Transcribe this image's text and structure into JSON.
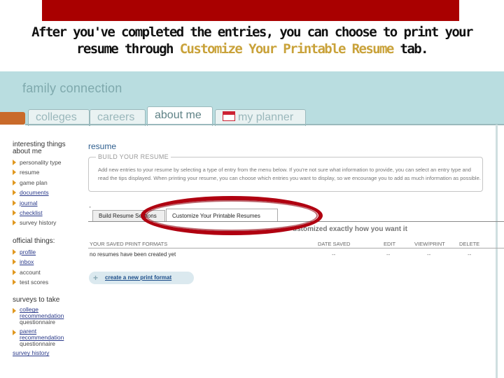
{
  "caption": {
    "line1": "After you've completed the entries, you can choose to print your",
    "line2_before": "resume through ",
    "line2_highlight": "Customize Your Printable Resume",
    "line2_after": " tab."
  },
  "app": {
    "brand": "family connection",
    "nav_tabs": [
      "colleges",
      "careers",
      "about me",
      "my planner"
    ],
    "sidebar": {
      "interesting_heading": "interesting things about me",
      "interesting_items": [
        {
          "label": "personality type",
          "underline": false
        },
        {
          "label": "resume",
          "underline": false
        },
        {
          "label": "game plan",
          "underline": false
        },
        {
          "label": "documents",
          "underline": true
        },
        {
          "label": "journal",
          "underline": true
        },
        {
          "label": "checklist",
          "underline": true
        },
        {
          "label": "survey history",
          "underline": false
        }
      ],
      "official_heading": "official things:",
      "official_items": [
        {
          "label": "profile",
          "underline": true
        },
        {
          "label": "inbox",
          "underline": true
        },
        {
          "label": "account",
          "underline": false
        },
        {
          "label": "test scores",
          "underline": false
        }
      ],
      "surveys_heading": "surveys to take",
      "survey_items": [
        {
          "line1": "college",
          "line2": "recommendation",
          "line3": "questionnaire"
        },
        {
          "line1": "parent",
          "line2": "recommendation",
          "line3": "questionnaire"
        }
      ],
      "survey_history": "survey history"
    },
    "main": {
      "title": "resume",
      "build_legend": "BUILD YOUR RESUME",
      "build_text": "Add new entries to your resume by selecting a type of entry from the menu below. If you're not sure what information to provide, you can select an entry type and read the tips displayed. When printing your resume, you can choose which entries you want to display, so we encourage you to add as much information as possible.",
      "subtabs": [
        "Build Resume Sections",
        "Customize Your Printable Resumes"
      ],
      "customized_text": "ustomized exactly how you want it",
      "table": {
        "headers": [
          "YOUR SAVED PRINT FORMATS",
          "DATE SAVED",
          "EDIT",
          "VIEW/PRINT",
          "DELETE"
        ],
        "row": [
          "no resumes have been created yet",
          "--",
          "--",
          "--",
          "--"
        ]
      },
      "create_button": "create a new print format"
    }
  },
  "colors": {
    "banner": "#a90000",
    "highlight": "#c9a23a",
    "header_band": "#b9dde0",
    "oval": "#b00010",
    "bullet": "#e09820",
    "link": "#2a3a8a"
  }
}
